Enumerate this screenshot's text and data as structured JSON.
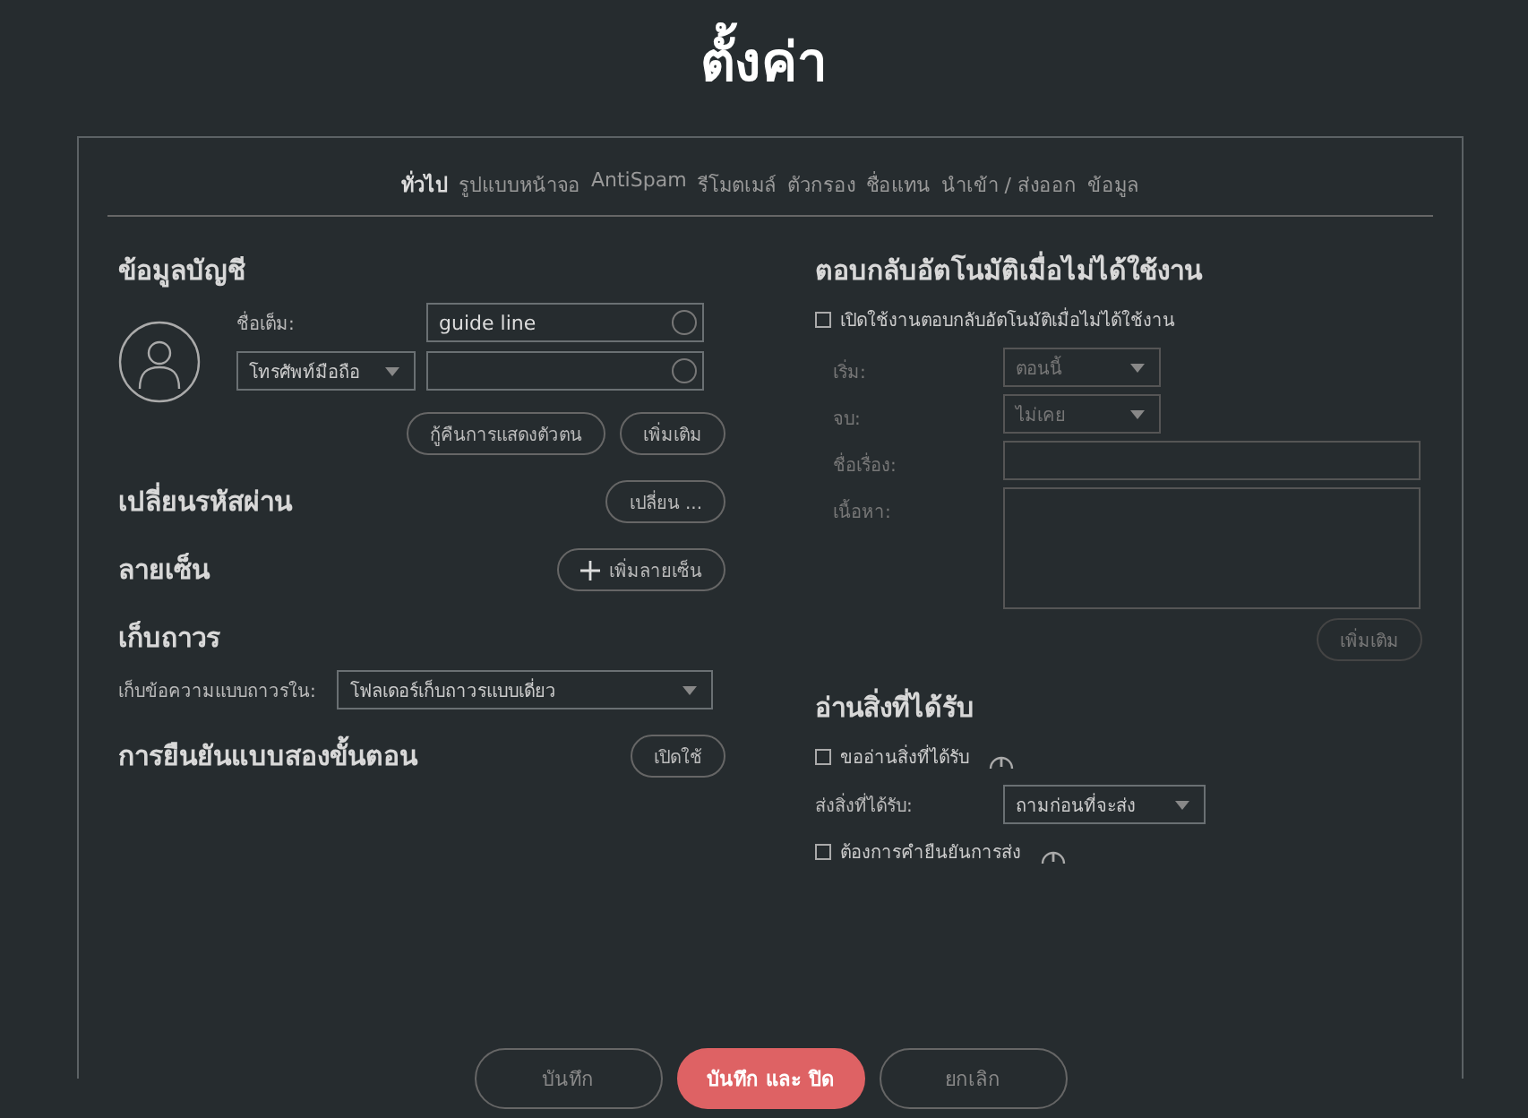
{
  "title": "ตั้งค่า",
  "tabs": [
    {
      "label": "ทั่วไป",
      "selected": true
    },
    {
      "label": "รูปแบบหน้าจอ",
      "selected": false
    },
    {
      "label": "AntiSpam",
      "selected": false
    },
    {
      "label": "รีโมตเมล์",
      "selected": false
    },
    {
      "label": "ตัวกรอง",
      "selected": false
    },
    {
      "label": "ชื่อแทน",
      "selected": false
    },
    {
      "label": "นำเข้า / ส่งออก",
      "selected": false
    },
    {
      "label": "ข้อมูล",
      "selected": false
    }
  ],
  "account": {
    "heading": "ข้อมูลบัญชี",
    "fullname_label": "ชื่อเต็ม:",
    "fullname_value": "guide line",
    "phone_type": "โทรศัพท์มือถือ",
    "buttons": [
      "กู้คืนการแสดงตัวตน",
      "เพิ่มเติม"
    ]
  },
  "password": {
    "heading": "เปลี่ยนรหัสผ่าน",
    "button": "เปลี่ยน ..."
  },
  "signature": {
    "heading": "ลายเซ็น",
    "button": "เพิ่มลายเซ็น"
  },
  "archive": {
    "heading": "เก็บถาวร",
    "label": "เก็บข้อความแบบถาวรใน:",
    "value": "โฟลเดอร์เก็บถาวรแบบเดี่ยว"
  },
  "two_factor": {
    "heading": "การยืนยันแบบสองขั้นตอน",
    "button": "เปิดใช้"
  },
  "auto_reply": {
    "heading": "ตอบกลับอัตโนมัติเมื่อไม่ได้ใช้งาน",
    "enable_label": "เปิดใช้งานตอบกลับอัตโนมัติเมื่อไม่ได้ใช้งาน",
    "checked": false,
    "fields": [
      {
        "label": "เริ่ม:",
        "kind": "select",
        "value": "ตอนนี้",
        "disabled": true
      },
      {
        "label": "จบ:",
        "kind": "select",
        "value": "ไม่เคย",
        "disabled": true
      },
      {
        "label": "ชื่อเรื่อง:",
        "kind": "text",
        "disabled": true
      },
      {
        "label": "เนื้อหา:",
        "kind": "textarea",
        "disabled": true
      }
    ],
    "button": "เพิ่มเติม"
  },
  "read_receipt": {
    "heading": "อ่านสิ่งที่ได้รับ",
    "request_label": "ขออ่านสิ่งที่ได้รับ",
    "request_checked": false,
    "send_label": "ส่งสิ่งที่ได้รับ:",
    "send_value": "ถามก่อนที่จะส่ง",
    "confirm_label": "ต้องการคำยืนยันการส่ง",
    "confirm_checked": false
  },
  "footer": [
    {
      "label": "บันทึก",
      "primary": false
    },
    {
      "label": "บันทึก และ ปิด",
      "primary": true
    },
    {
      "label": "ยกเลิก",
      "primary": false
    }
  ]
}
